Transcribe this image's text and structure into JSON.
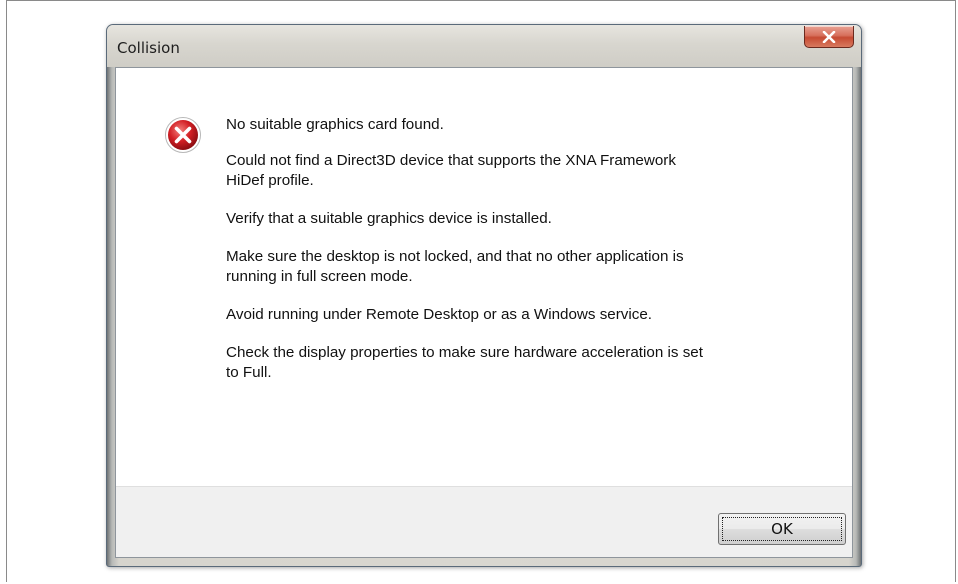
{
  "dialog": {
    "title": "Collision",
    "icon": "error-icon",
    "messages": [
      "No suitable graphics card found.",
      "Could not find a Direct3D device that supports the XNA Framework\nHiDef profile.",
      "Verify that a suitable graphics device is installed.",
      "Make sure the desktop is not locked, and that no other application is\nrunning in full screen mode.",
      "Avoid running under Remote Desktop or as a Windows service.",
      "Check the display properties to make sure hardware acceleration is set\nto Full."
    ],
    "ok_label": "OK",
    "close_icon": "close-icon"
  },
  "colors": {
    "close_button": "#c64a32",
    "error_icon": "#c8102e",
    "client_background": "#ffffff",
    "button_area": "#f0f0f0"
  }
}
